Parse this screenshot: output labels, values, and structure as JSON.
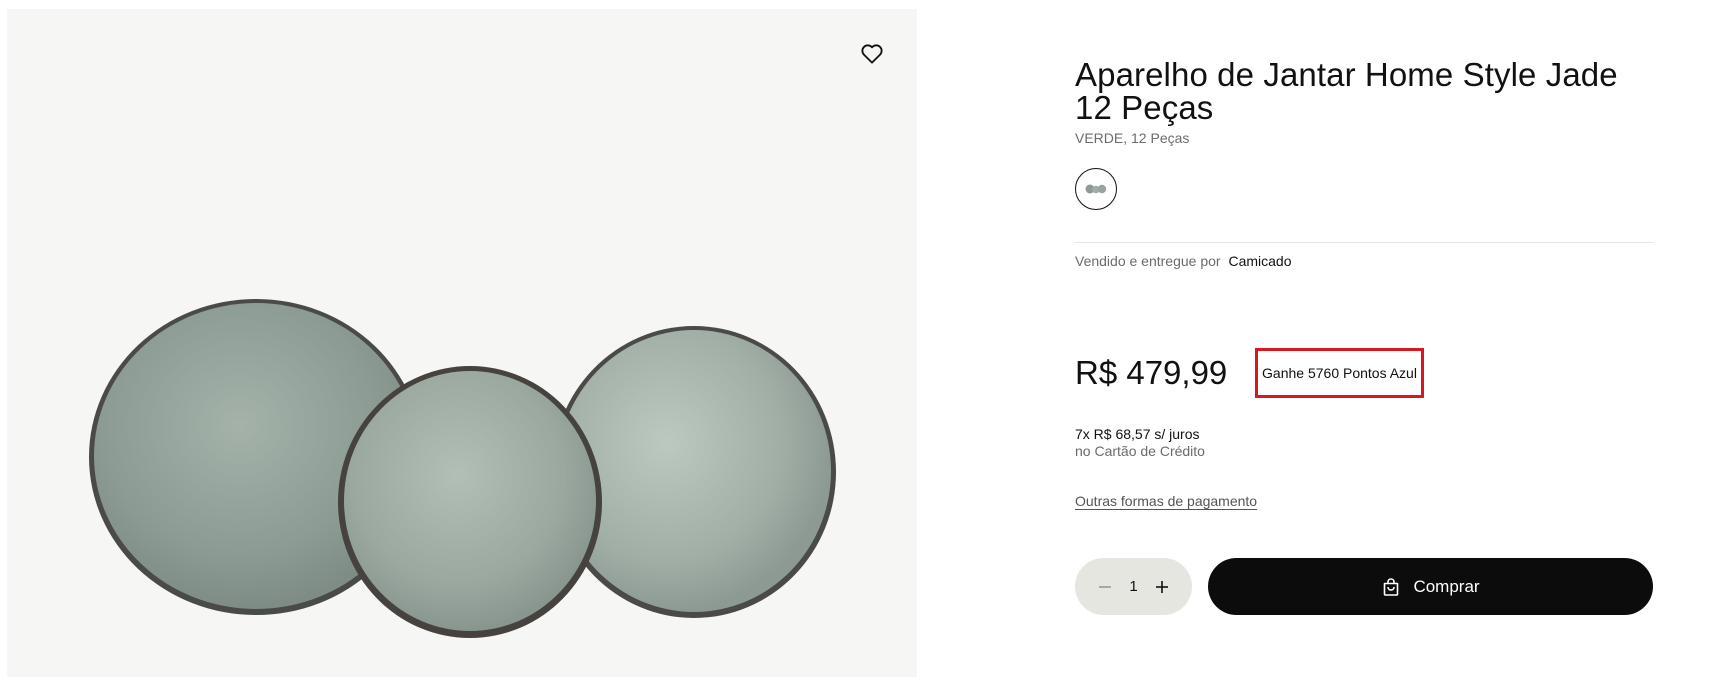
{
  "product": {
    "title": "Aparelho de Jantar Home Style Jade 12 Peças",
    "variant": "VERDE, 12 Peças",
    "seller_prefix": "Vendido e entregue por",
    "seller_name": "Camicado",
    "price": "R$ 479,99",
    "points": "Ganhe 5760 Pontos Azul",
    "installments_value": "7x R$ 68,57 s/ juros",
    "installments_method": "no Cartão de Crédito",
    "other_payments": "Outras formas de pagamento"
  },
  "purchase": {
    "quantity": "1",
    "buy_label": "Comprar"
  },
  "icons": {
    "wishlist": "heart-icon",
    "swatch": "color-swatch-thumbnail",
    "minus": "minus-icon",
    "plus": "plus-icon",
    "bag": "shopping-bag-icon"
  },
  "colors": {
    "accent_border": "#d7191f",
    "button_bg": "#0c0c0c",
    "qty_bg": "#e6e6e1"
  }
}
